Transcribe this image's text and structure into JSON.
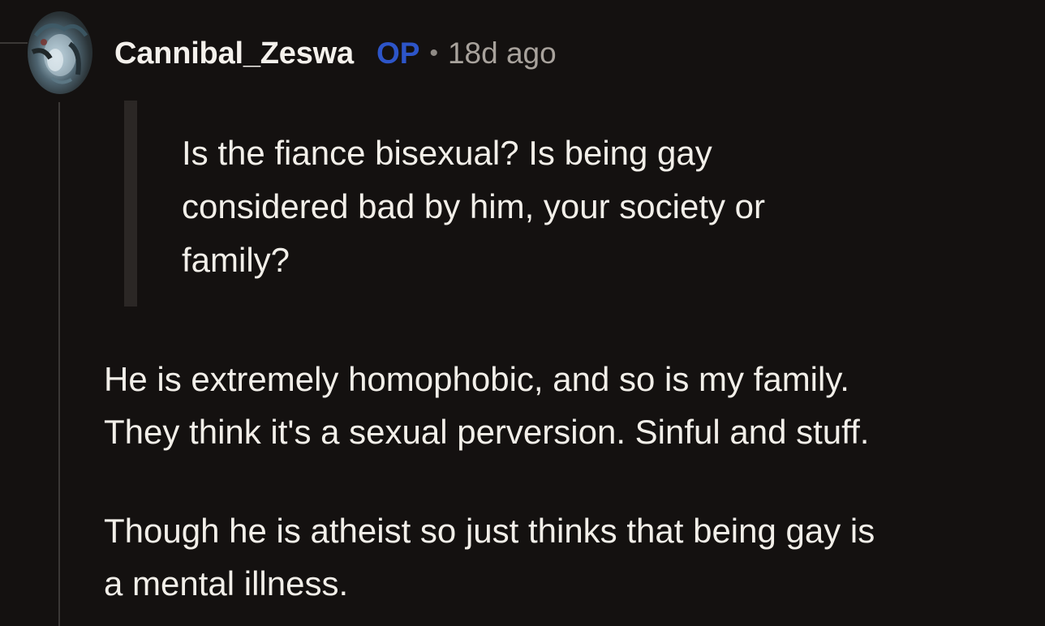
{
  "comment": {
    "username": "Cannibal_Zeswa",
    "op_badge": "OP",
    "separator": "•",
    "timestamp": "18d ago",
    "quote_lines": [
      "Is the fiance bisexual? Is being gay",
      "considered bad by him, your society or",
      "family?"
    ],
    "paragraphs": [
      {
        "lines": [
          "He is extremely homophobic, and so is my family.",
          "They think it's a sexual perversion. Sinful and stuff."
        ]
      },
      {
        "lines": [
          "Though he is atheist so just thinks that being gay is",
          "a mental illness."
        ]
      }
    ]
  },
  "colors": {
    "background": "#141110",
    "text": "#f2efe9",
    "op_badge": "#2d55c8",
    "meta": "#a8a29c",
    "thread_line": "#3b3836",
    "quote_bar": "#2b2725"
  }
}
